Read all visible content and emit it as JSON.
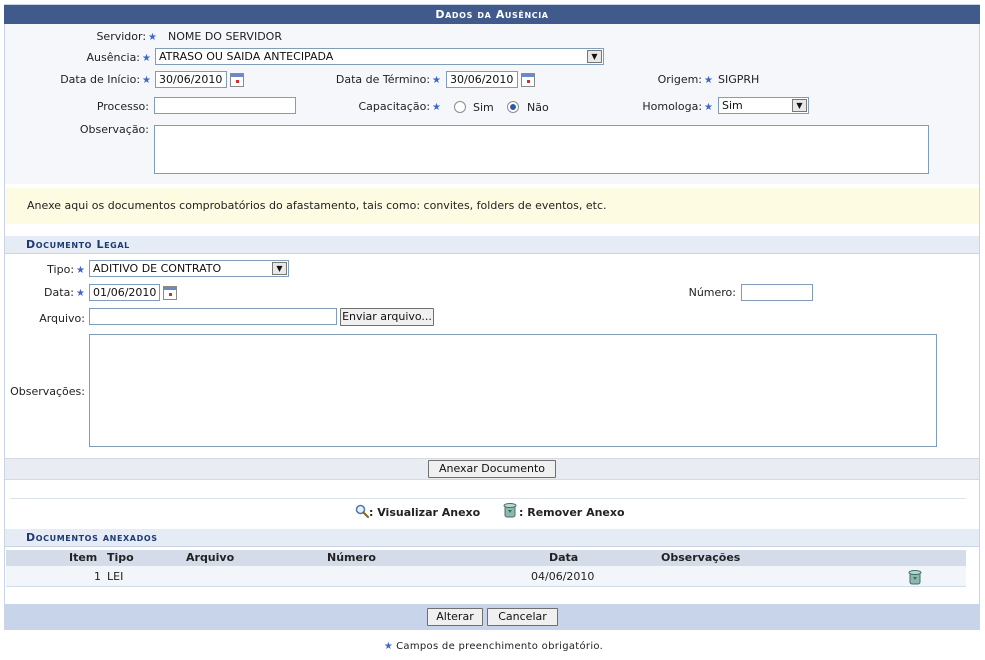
{
  "header": {
    "title": "Dados da Ausência"
  },
  "form": {
    "servidor_label": "Servidor:",
    "servidor_value": "NOME DO SERVIDOR",
    "ausencia_label": "Ausência:",
    "ausencia_value": "ATRASO OU SAIDA ANTECIPADA",
    "data_inicio_label": "Data de Início:",
    "data_inicio_value": "30/06/2010",
    "data_termino_label": "Data de Término:",
    "data_termino_value": "30/06/2010",
    "origem_label": "Origem:",
    "origem_value": "SIGPRH",
    "processo_label": "Processo:",
    "processo_value": "",
    "capacitacao_label": "Capacitação:",
    "capacitacao_sim": "Sim",
    "capacitacao_nao": "Não",
    "capacitacao_selected": "Não",
    "homologa_label": "Homologa:",
    "homologa_value": "Sim",
    "observacao_label": "Observação:"
  },
  "notice": {
    "text": "Anexe aqui os documentos comprobatórios do afastamento, tais como: convites, folders de eventos, etc."
  },
  "documento_legal": {
    "title": "Documento Legal",
    "tipo_label": "Tipo:",
    "tipo_value": "ADITIVO DE CONTRATO",
    "data_label": "Data:",
    "data_value": "01/06/2010",
    "numero_label": "Número:",
    "numero_value": "",
    "arquivo_label": "Arquivo:",
    "arquivo_value": "",
    "enviar_button": "Enviar arquivo...",
    "observacoes_label": "Observações:",
    "anexar_button": "Anexar Documento"
  },
  "legend": {
    "visualizar": ": Visualizar Anexo",
    "remover": ": Remover Anexo"
  },
  "anexados": {
    "title": "Documentos anexados",
    "columns": [
      "Item",
      "Tipo",
      "Arquivo",
      "Número",
      "Data",
      "Observações"
    ],
    "rows": [
      {
        "item": "1",
        "tipo": "LEI",
        "arquivo": "",
        "numero": "",
        "data": "04/06/2010",
        "observacoes": ""
      }
    ]
  },
  "actions": {
    "alterar": "Alterar",
    "cancelar": "Cancelar"
  },
  "footer": {
    "note": "Campos de preenchimento obrigatório."
  },
  "icons": {
    "required": "star-icon",
    "calendar": "calendar-icon",
    "view": "magnifier-icon",
    "remove": "trash-icon"
  },
  "colors": {
    "title_bar": "#405a8c",
    "section_text": "#1f3a73",
    "notice_bg": "#fdfce2",
    "required_star": "#3f67c8"
  }
}
